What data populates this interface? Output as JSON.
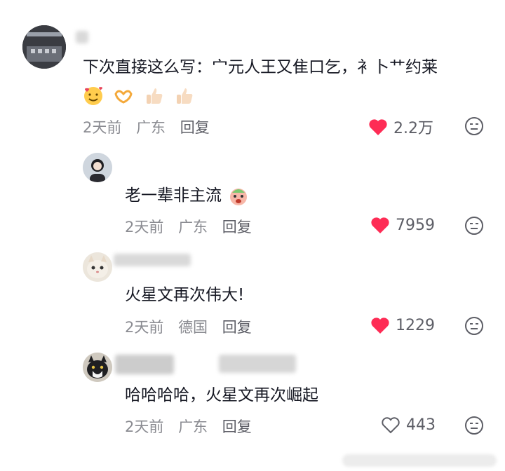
{
  "comments": [
    {
      "text": "下次直接这么写：宀元人王又隹口乞，衤卜艹约莱",
      "time": "2天前",
      "location": "广东",
      "reply_label": "回复",
      "likes": "2.2万",
      "liked": true
    },
    {
      "text": "老一辈非主流",
      "time": "2天前",
      "location": "广东",
      "reply_label": "回复",
      "likes": "7959",
      "liked": true
    },
    {
      "text": "火星文再次伟大!",
      "time": "2天前",
      "location": "德国",
      "reply_label": "回复",
      "likes": "1229",
      "liked": true
    },
    {
      "text": "哈哈哈哈，火星文再次崛起",
      "time": "2天前",
      "location": "广东",
      "reply_label": "回复",
      "likes": "443",
      "liked": false
    }
  ],
  "colors": {
    "like_active": "#fe2c55",
    "meta": "#8a8b91",
    "text": "#161823"
  },
  "icons": {
    "like": "heart-icon",
    "dislike": "dislike-face-icon"
  }
}
